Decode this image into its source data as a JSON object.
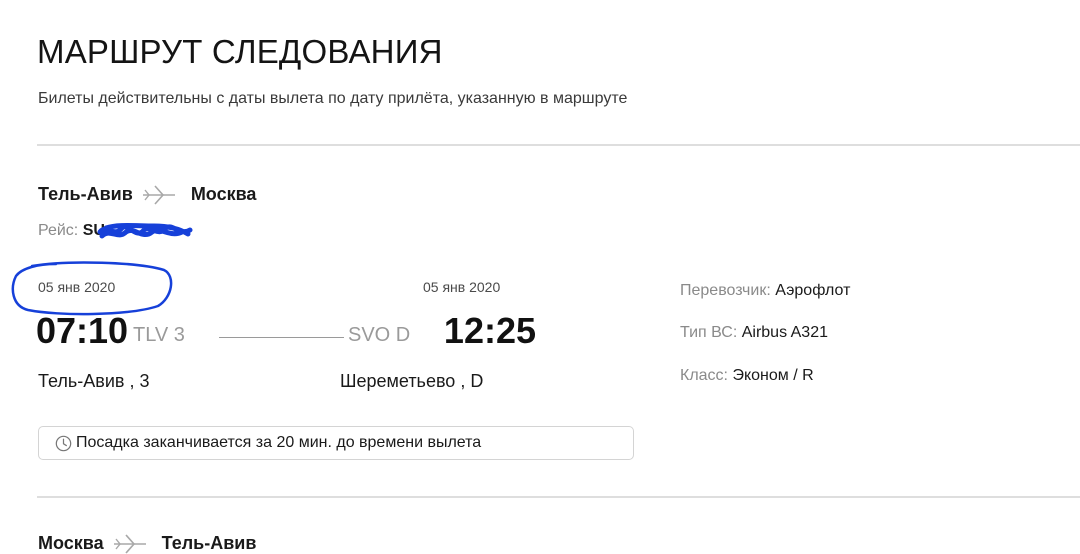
{
  "header": {
    "title": "МАРШРУТ СЛЕДОВАНИЯ",
    "subtitle": "Билеты действительны с даты вылета по дату прилёта, указанную в маршруте"
  },
  "segments": [
    {
      "from_city": "Тель-Авив",
      "to_city": "Москва",
      "flight_label": "Рейс:",
      "flight_number": "SU",
      "departure": {
        "date": "05 янв 2020",
        "time": "07:10",
        "code": "TLV 3",
        "place": "Тель-Авив , 3"
      },
      "arrival": {
        "date": "05 янв 2020",
        "time": "12:25",
        "code": "SVO D",
        "place": "Шереметьево , D"
      },
      "notice": "Посадка заканчивается за 20 мин. до времени вылета",
      "details": [
        {
          "label": "Перевозчик:",
          "value": "Аэрофлот"
        },
        {
          "label": "Тип ВС:",
          "value": "Airbus A321"
        },
        {
          "label": "Класс:",
          "value": "Эконом / R"
        }
      ]
    },
    {
      "from_city": "Москва",
      "to_city": "Тель-Авив"
    }
  ],
  "colors": {
    "annotation_ink": "#1640d9",
    "divider": "#dedede",
    "muted_text": "#8a8a8a"
  },
  "icons": [
    "airplane-icon",
    "clock-icon"
  ]
}
